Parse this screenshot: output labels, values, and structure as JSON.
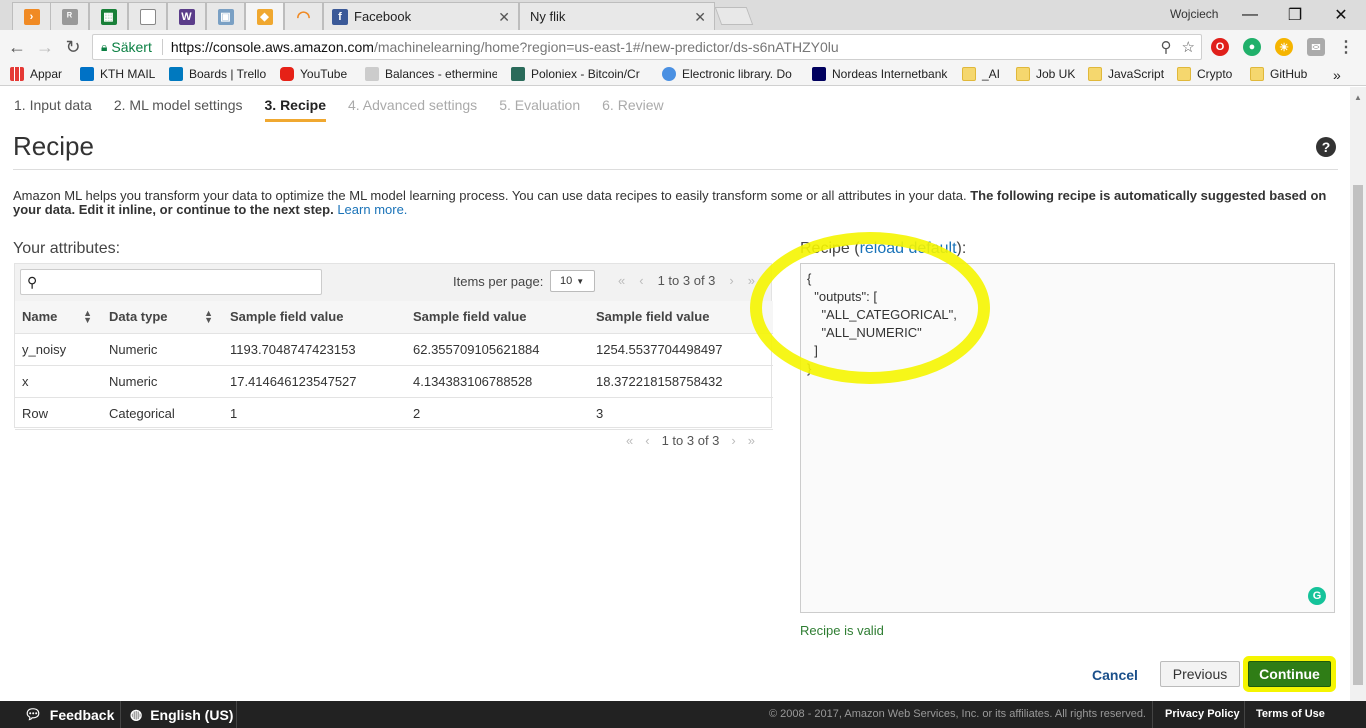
{
  "browser": {
    "tabs": [
      {
        "icon": "aws-icon",
        "label": ""
      },
      {
        "icon": "ethermine-icon",
        "label": ""
      },
      {
        "icon": "sheets-icon",
        "label": ""
      },
      {
        "icon": "document-icon",
        "label": ""
      },
      {
        "icon": "w-icon",
        "label": ""
      },
      {
        "icon": "image-icon",
        "label": ""
      },
      {
        "icon": "aws-box-icon",
        "label": ""
      },
      {
        "icon": "loading-icon",
        "label": ""
      },
      {
        "icon": "facebook-icon",
        "label": "Facebook"
      },
      {
        "icon": "",
        "label": "Ny flik"
      }
    ],
    "user": "Wojciech",
    "address": {
      "secure_label": "Säkert",
      "url_host": "https://console.aws.amazon.com",
      "url_path": "/machinelearning/home?region=us-east-1#/new-predictor/ds-s6nATHZY0lu"
    },
    "bookmarks": [
      {
        "label": "Appar"
      },
      {
        "label": "KTH MAIL"
      },
      {
        "label": "Boards | Trello"
      },
      {
        "label": "YouTube"
      },
      {
        "label": "Balances - ethermine"
      },
      {
        "label": "Poloniex - Bitcoin/Cr"
      },
      {
        "label": "Electronic library. Do"
      },
      {
        "label": "Nordeas Internetbank"
      },
      {
        "label": "_AI"
      },
      {
        "label": "Job UK"
      },
      {
        "label": "JavaScript"
      },
      {
        "label": "Crypto"
      },
      {
        "label": "GitHub"
      }
    ],
    "more_bookmarks": "»"
  },
  "wizard": {
    "steps": [
      {
        "label": "1. Input data",
        "state": "done"
      },
      {
        "label": "2. ML model settings",
        "state": "done"
      },
      {
        "label": "3. Recipe",
        "state": "active"
      },
      {
        "label": "4. Advanced settings",
        "state": "disabled"
      },
      {
        "label": "5. Evaluation",
        "state": "disabled"
      },
      {
        "label": "6. Review",
        "state": "disabled"
      }
    ]
  },
  "page": {
    "title": "Recipe",
    "description_plain": "Amazon ML helps you transform your data to optimize the ML model learning process. You can use data recipes to easily transform some or all attributes in your data. ",
    "description_bold": "The following recipe is automatically suggested based on your data. Edit it inline, or continue to the next step.",
    "learn_more": "Learn more."
  },
  "attributes": {
    "label": "Your attributes:",
    "search_placeholder": "",
    "items_per_page_label": "Items per page:",
    "items_per_page_value": "10",
    "pager_text": "1 to 3 of 3",
    "columns": [
      "Name",
      "Data type",
      "Sample field value",
      "Sample field value",
      "Sample field value"
    ],
    "rows": [
      [
        "y_noisy",
        "Numeric",
        "1193.7048747423153",
        "62.355709105621884",
        "1254.5537704498497"
      ],
      [
        "x",
        "Numeric",
        "17.414646123547527",
        "4.134383106788528",
        "18.372218158758432"
      ],
      [
        "Row",
        "Categorical",
        "1",
        "2",
        "3"
      ]
    ]
  },
  "recipe": {
    "label_prefix": "Recipe (",
    "reload_link": "reload default",
    "label_suffix": "):",
    "content": "{\n  \"outputs\": [\n    \"ALL_CATEGORICAL\",\n    \"ALL_NUMERIC\"\n  ]\n}",
    "status": "Recipe is valid"
  },
  "actions": {
    "cancel": "Cancel",
    "previous": "Previous",
    "continue": "Continue"
  },
  "footer": {
    "feedback": "Feedback",
    "language": "English (US)",
    "copyright": "© 2008 - 2017, Amazon Web Services, Inc. or its affiliates. All rights reserved.",
    "privacy": "Privacy Policy",
    "terms": "Terms of Use"
  },
  "colors": {
    "accent_tab": "#f0a830",
    "continue_button": "#2f7d16",
    "highlight": "#f5f500",
    "link": "#1a73b8"
  }
}
